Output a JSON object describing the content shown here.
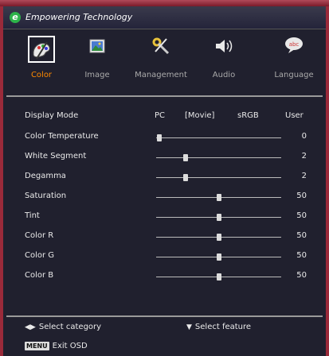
{
  "header": {
    "brand_text": "Empowering Technology",
    "logo_letter": "e"
  },
  "tabs": [
    {
      "label": "Color",
      "icon": "palette-icon",
      "active": true
    },
    {
      "label": "Image",
      "icon": "image-icon",
      "active": false
    },
    {
      "label": "Management",
      "icon": "tools-icon",
      "active": false
    },
    {
      "label": "Audio",
      "icon": "speaker-icon",
      "active": false
    },
    {
      "label": "Language",
      "icon": "speech-bubble-icon",
      "active": false
    }
  ],
  "settings": {
    "display_mode": {
      "label": "Display Mode",
      "options": [
        "PC",
        "[Movie]",
        "sRGB",
        "User"
      ],
      "selected": "Movie"
    },
    "sliders": [
      {
        "label": "Color Temperature",
        "value": "0",
        "fraction": 0.0
      },
      {
        "label": "White Segment",
        "value": "2",
        "fraction": 0.22
      },
      {
        "label": "Degamma",
        "value": "2",
        "fraction": 0.22
      },
      {
        "label": "Saturation",
        "value": "50",
        "fraction": 0.5
      },
      {
        "label": "Tint",
        "value": "50",
        "fraction": 0.5
      },
      {
        "label": "Color R",
        "value": "50",
        "fraction": 0.5
      },
      {
        "label": "Color G",
        "value": "50",
        "fraction": 0.5
      },
      {
        "label": "Color B",
        "value": "50",
        "fraction": 0.5
      }
    ]
  },
  "footer": {
    "select_category": "Select category",
    "select_feature": "Select feature",
    "menu_key": "MENU",
    "exit_osd": "Exit OSD"
  },
  "colors": {
    "accent": "#ff8a00",
    "frame": "#9a2a3a",
    "logo": "#2db34a"
  }
}
